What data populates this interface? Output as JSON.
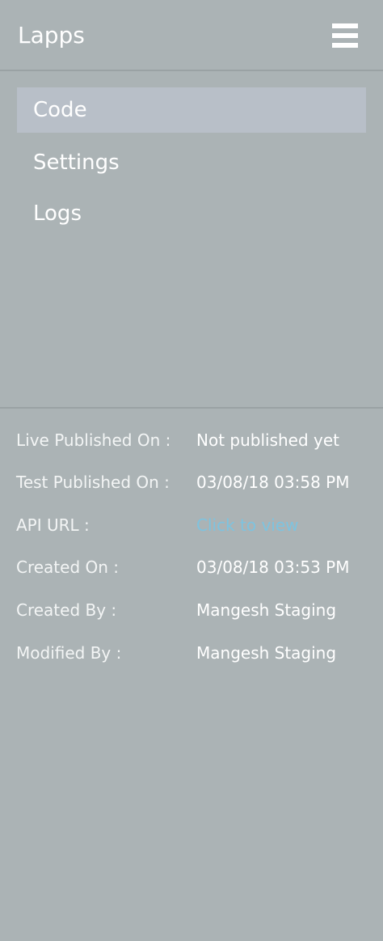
{
  "header": {
    "title": "Lapps",
    "menu_icon": "hamburger-menu-icon"
  },
  "nav": {
    "items": [
      {
        "label": "Code",
        "active": true
      },
      {
        "label": "Settings",
        "active": false
      },
      {
        "label": "Logs",
        "active": false
      }
    ]
  },
  "details": {
    "rows": [
      {
        "label": "Live Published On :",
        "value": "Not published yet"
      },
      {
        "label": "Test Published On :",
        "value": "03/08/18 03:58 PM"
      },
      {
        "label": "API URL :",
        "value": "Click to view"
      },
      {
        "label": "Created On :",
        "value": "03/08/18 03:53 PM"
      },
      {
        "label": "Created By :",
        "value": "Mangesh Staging"
      },
      {
        "label": "Modified By :",
        "value": "Mangesh Staging"
      }
    ]
  },
  "colors": {
    "background": "#abb3b5",
    "active_item": "#b8bfc8",
    "link": "#7ec3df",
    "text": "#ffffff"
  }
}
